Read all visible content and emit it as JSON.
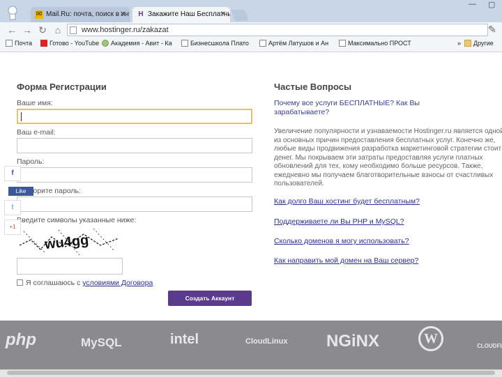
{
  "browser": {
    "tabs": [
      {
        "title": "Mail.Ru: почта, поиск в инт"
      },
      {
        "title": "Закажите Наш Бесплатный"
      }
    ],
    "url": "www.hostinger.ru/zakazat",
    "bookmarks": [
      "Почта",
      "Готово - YouTube",
      "Академия - Авит - Ка",
      "Бизнесшкола Плато",
      "Артём Латушов и Ан",
      "Максимально ПРОСТ",
      "Другие"
    ]
  },
  "form": {
    "title": "Форма Регистрации",
    "name_label": "Ваше имя:",
    "email_label": "Ваш e-mail:",
    "password_label": "Пароль:",
    "repeat_label": "Повторите пароль:",
    "captcha_label": "Введите символы указанные ниже:",
    "captcha_text": "wu4gg",
    "agree_text": "Я соглашаюсь с ",
    "agree_link": "условиями Договора",
    "submit": "Создать Аккаунт"
  },
  "faq": {
    "title": "Частые Вопросы",
    "question": "Почему все услуги БЕСПЛАТНЫЕ? Как Вы зарабатываете?",
    "answer": "Увеличение популярности и узнаваемости Hostinger.ru является одной из основных причин предоставления бесплатных услуг. Конечно же, любые виды продвижения разработка маркетинговой стратегии стоит денег. Мы покрываем эти затраты предоставляя услуги платных обновлений для тех, кому необходимо больше ресурсов. Также, ежедневно мы получаем благотворительные взносы от счастливых пользователей.",
    "links": [
      "Как долго Ваш хостинг будет бесплатным?",
      "Поддерживаете ли Вы PHP и MySQL?",
      "Сколько доменов я могу использовать?",
      "Как направить мой домен на Ваш сервер?"
    ]
  },
  "social": {
    "fb_like": "Like",
    "gplus": "+1"
  },
  "footer_logos": [
    "php",
    "MySQL",
    "intel",
    "CloudLinux",
    "NGiNX",
    "W",
    "CLOUDFLARE"
  ]
}
